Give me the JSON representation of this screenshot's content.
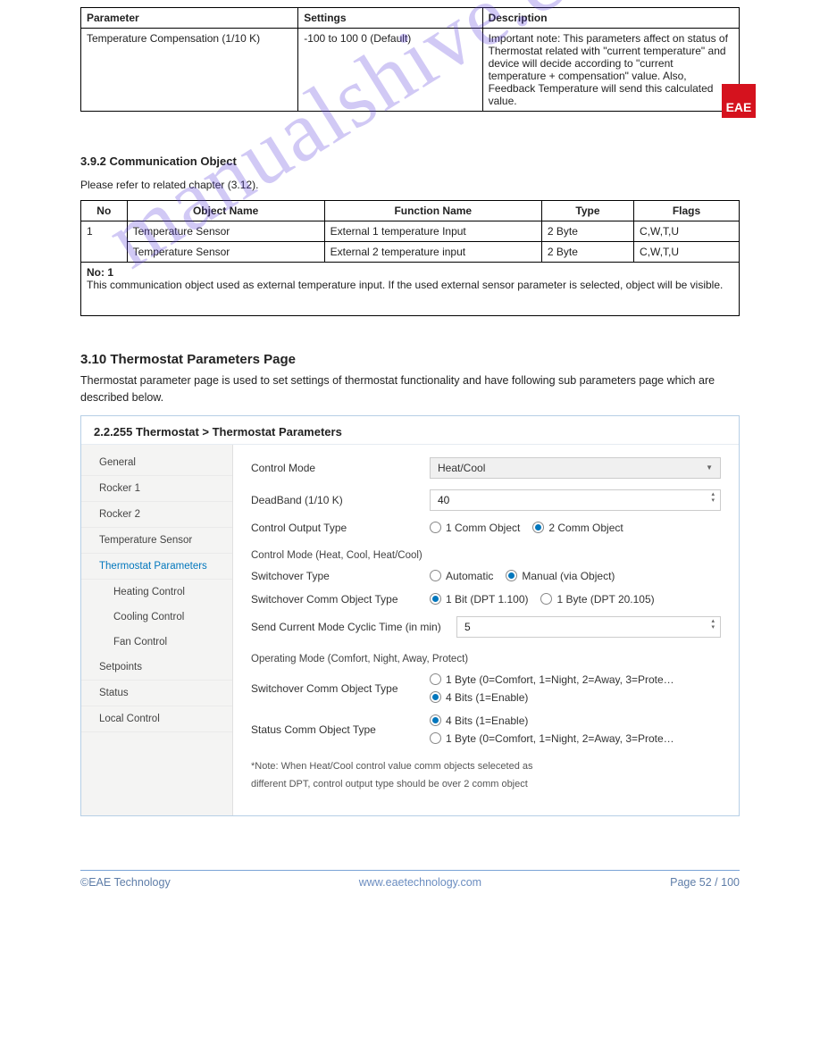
{
  "logo": "EAE",
  "watermark": "manualshive.com",
  "table1": {
    "headers": [
      "Parameter",
      "Settings",
      "Description"
    ],
    "cells": [
      "Temperature Compensation (1/10 K)",
      "-100 to 100 0 (Default)",
      "Important note: This parameters affect on status of Thermostat related with \"current temperature\" and device will decide according to \"current temperature + compensation\" value. Also, Feedback Temperature will send this calculated value."
    ]
  },
  "section2": {
    "title": "3.9.2  Communication Object",
    "sub": "Please refer to related chapter (3.12)."
  },
  "table2": {
    "headers": [
      "No",
      "Object Name",
      "Function Name",
      "Type",
      "Flags"
    ],
    "rows": [
      [
        "1",
        "Temperature Sensor",
        "External 1 temperature Input",
        "2 Byte",
        "C,W,T,U"
      ],
      [
        "",
        "Temperature Sensor",
        "External 2 temperature input",
        "2 Byte",
        "C,W,T,U"
      ]
    ],
    "footerHead": "No: 1",
    "footerBody": "This communication object used as external temperature input. If the used external sensor parameter is selected, object will be visible."
  },
  "heading": "3.10  Thermostat Parameters Page",
  "para": "Thermostat parameter page is used to set settings of thermostat functionality and have following sub parameters page which are described below.",
  "app": {
    "breadcrumb": "2.2.255 Thermostat > Thermostat Parameters",
    "sidebar": [
      "General",
      "Rocker 1",
      "Rocker 2",
      "Temperature Sensor",
      "Thermostat Parameters",
      "Heating Control",
      "Cooling Control",
      "Fan Control",
      "Setpoints",
      "Status",
      "Local Control"
    ],
    "activeIndex": 4,
    "subIndices": [
      5,
      6,
      7
    ],
    "controlModeLabel": "Control Mode",
    "controlModeValue": "Heat/Cool",
    "deadBandLabel": "DeadBand (1/10 K)",
    "deadBandValue": "40",
    "outputTypeLabel": "Control Output Type",
    "outputOpt1": "1 Comm Object",
    "outputOpt2": "2 Comm Object",
    "group1Head": "Control Mode (Heat, Cool, Heat/Cool)",
    "switchTypeLabel": "Switchover Type",
    "switchOpt1": "Automatic",
    "switchOpt2": "Manual (via Object)",
    "switchObjLabel": "Switchover Comm Object Type",
    "switchObjOpt1": "1 Bit (DPT 1.100)",
    "switchObjOpt2": "1 Byte (DPT 20.105)",
    "cyclicLabel": "Send Current Mode Cyclic Time (in min)",
    "cyclicValue": "5",
    "group2Head": "Operating Mode (Comfort, Night, Away, Protect)",
    "opSwitchLabel": "Switchover Comm Object Type",
    "opOptA1": "1 Byte (0=Comfort, 1=Night, 2=Away, 3=Prote…",
    "opOptA2": "4 Bits (1=Enable)",
    "statusLabel": "Status Comm Object Type",
    "opOptB1": "4 Bits (1=Enable)",
    "opOptB2": "1 Byte (0=Comfort, 1=Night, 2=Away, 3=Prote…",
    "note1": "*Note: When Heat/Cool control value comm objects seleceted as",
    "note2": "different DPT, control output type should be over 2 comm object"
  },
  "footer": {
    "left": "©EAE Technology",
    "right": "www.eaetechnology.com",
    "page": "Page 52 / 100"
  }
}
